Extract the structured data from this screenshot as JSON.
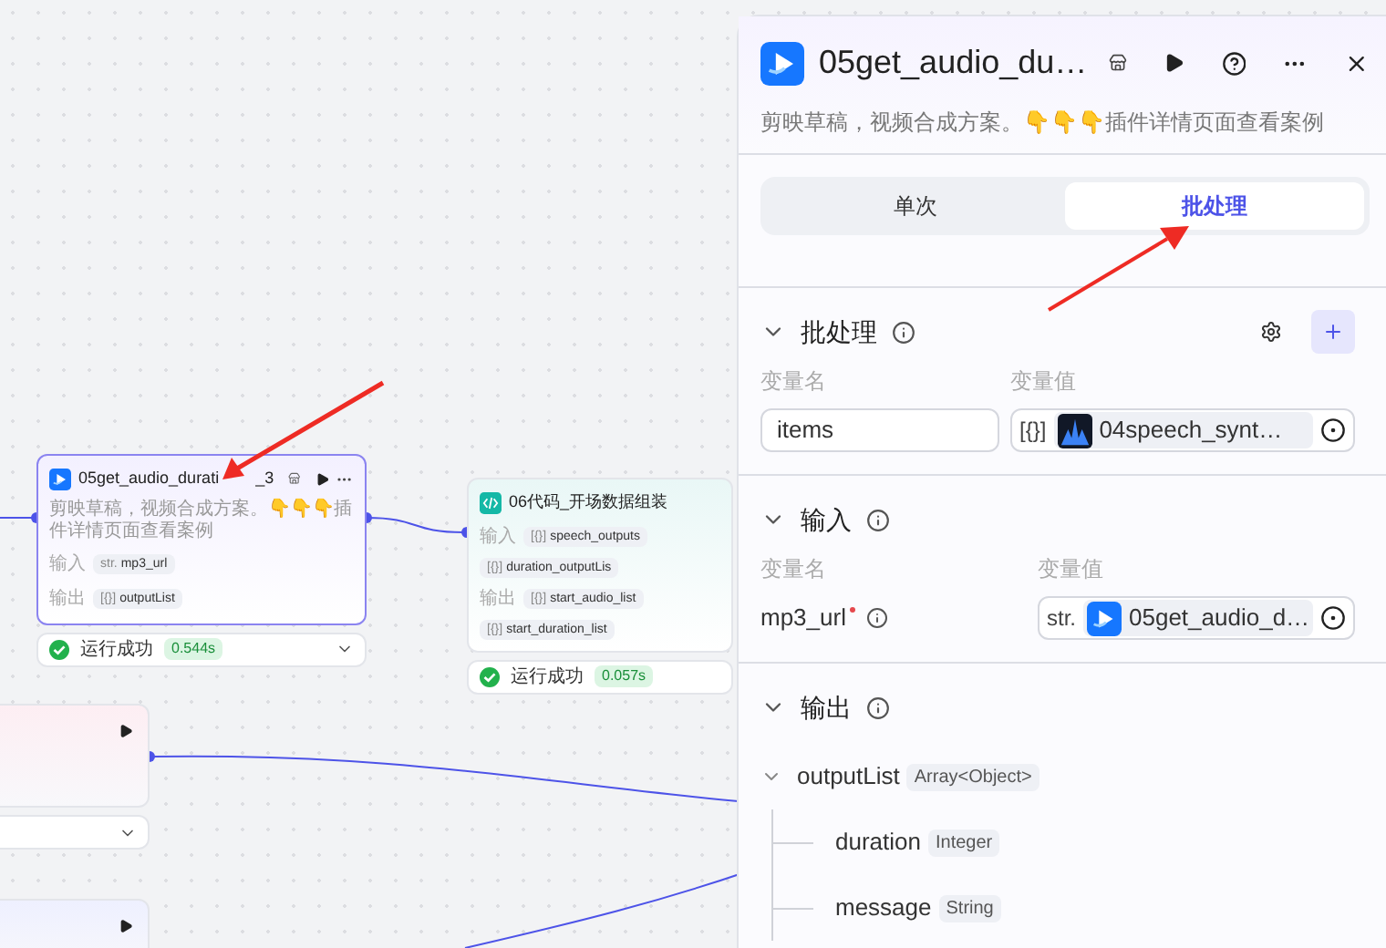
{
  "canvas": {
    "nodes": [
      {
        "kind": "plugin",
        "title": "05get_audio_durati",
        "title_end": "_3",
        "selected": true,
        "description": "剪映草稿，视频合成方案。👇👇👇插件详情页面查看案例",
        "inputs_label": "输入",
        "inputs": [
          {
            "type": "str.",
            "name": "mp3_url"
          }
        ],
        "outputs_label": "输出",
        "outputs": [
          {
            "type": "[{}]",
            "name": "outputList"
          }
        ],
        "status": "运行成功",
        "time": "0.544s"
      },
      {
        "kind": "code",
        "title": "06代码_开场数据组装",
        "selected": false,
        "inputs_label": "输入",
        "inputs": [
          {
            "type": "[{}]",
            "name": "speech_outputs"
          },
          {
            "type": "[{}]",
            "name": "duration_outputLis"
          }
        ],
        "outputs_label": "输出",
        "outputs": [
          {
            "type": "[{}]",
            "name": "start_audio_list"
          },
          {
            "type": "[{}]",
            "name": "start_duration_list"
          }
        ],
        "status": "运行成功",
        "time": "0.057s"
      }
    ]
  },
  "panel": {
    "title": "05get_audio_du…",
    "description": "剪映草稿，视频合成方案。👇👇👇插件详情页面查看案例",
    "tabs": [
      {
        "label": "单次",
        "selected": false
      },
      {
        "label": "批处理",
        "selected": true
      }
    ],
    "batch": {
      "title": "批处理",
      "expanded": true,
      "name_header": "变量名",
      "value_header": "变量值",
      "rows": [
        {
          "name": "items",
          "type": "[{}]",
          "source": "04speech_synt…"
        }
      ]
    },
    "inputs": {
      "title": "输入",
      "expanded": true,
      "name_header": "变量名",
      "value_header": "变量值",
      "rows": [
        {
          "name": "mp3_url",
          "required": true,
          "type": "str.",
          "source": "05get_audio_d…"
        }
      ]
    },
    "outputs": {
      "title": "输出",
      "expanded": true,
      "tree": [
        {
          "name": "outputList",
          "type": "Array<Object>",
          "expanded": true,
          "children": [
            {
              "name": "duration",
              "type": "Integer"
            },
            {
              "name": "message",
              "type": "String"
            }
          ]
        }
      ]
    }
  }
}
